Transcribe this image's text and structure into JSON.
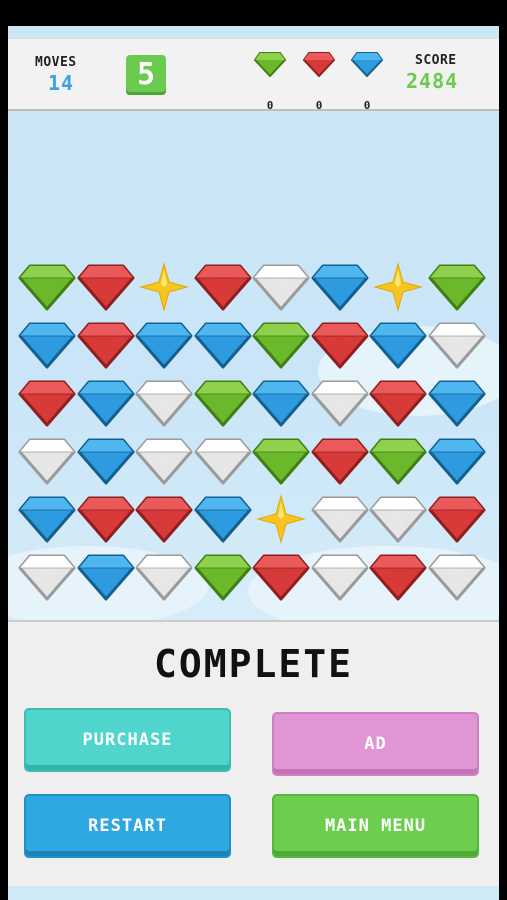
{
  "hud": {
    "moves_label": "MOVES",
    "moves_value": "14",
    "level_badge": "5",
    "score_label": "SCORE",
    "score_value": "2484",
    "gem_counters": [
      {
        "icon": "green-gem-icon",
        "count": "0",
        "color": "#6bb82a"
      },
      {
        "icon": "red-gem-icon",
        "count": "0",
        "color": "#d83a3a"
      },
      {
        "icon": "blue-gem-icon",
        "count": "0",
        "color": "#2e9be0"
      }
    ]
  },
  "colors": {
    "green": "#6bb82a",
    "red": "#d83a3a",
    "blue": "#2e9be0",
    "white": "#f2f2f2",
    "star": "#f7c520",
    "moves_value": "#3aa3e0",
    "score_value": "#6acb4e"
  },
  "board": {
    "rows": [
      [
        "green",
        "red",
        "star",
        "red",
        "white",
        "blue",
        "star",
        "green"
      ],
      [
        "blue",
        "red",
        "blue",
        "blue",
        "green",
        "red",
        "blue",
        "white"
      ],
      [
        "red",
        "blue",
        "white",
        "green",
        "blue",
        "white",
        "red",
        "blue"
      ],
      [
        "white",
        "blue",
        "white",
        "white",
        "green",
        "red",
        "green",
        "blue"
      ],
      [
        "blue",
        "red",
        "red",
        "blue",
        "star",
        "white",
        "white",
        "red"
      ],
      [
        "white",
        "blue",
        "white",
        "green",
        "red",
        "white",
        "red",
        "white"
      ]
    ]
  },
  "panel": {
    "title": "COMPLETE",
    "buttons": {
      "purchase": "PURCHASE",
      "ad": "AD",
      "restart": "RESTART",
      "main_menu": "MAIN MENU"
    }
  }
}
